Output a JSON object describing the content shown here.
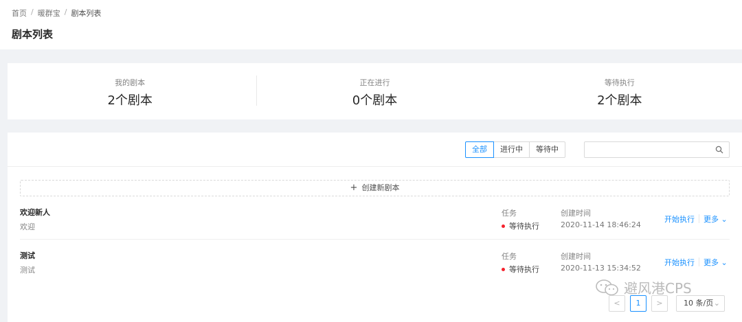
{
  "breadcrumb": [
    "首页",
    "暖群宝",
    "剧本列表"
  ],
  "breadcrumb_sep": "/",
  "page_title": "剧本列表",
  "stats": [
    {
      "label": "我的剧本",
      "value": "2个剧本"
    },
    {
      "label": "正在进行",
      "value": "0个剧本"
    },
    {
      "label": "等待执行",
      "value": "2个剧本"
    }
  ],
  "filters": [
    "全部",
    "进行中",
    "等待中"
  ],
  "active_filter": "全部",
  "search": {
    "value": "",
    "placeholder": ""
  },
  "create_label": "创建新剧本",
  "columns": {
    "task": "任务",
    "created": "创建时间"
  },
  "rows": [
    {
      "title": "欢迎新人",
      "desc": "欢迎",
      "status": "等待执行",
      "created": "2020-11-14 18:46:24",
      "action": "开始执行",
      "more": "更多"
    },
    {
      "title": "测试",
      "desc": "测试",
      "status": "等待执行",
      "created": "2020-11-13 15:34:52",
      "action": "开始执行",
      "more": "更多"
    }
  ],
  "pagination": {
    "prev": "<",
    "current": "1",
    "next": ">",
    "page_size": "10 条/页"
  },
  "watermark": "避风港CPS",
  "colors": {
    "accent": "#1890ff",
    "status_dot": "#f5222d",
    "background": "#f0f2f5"
  }
}
